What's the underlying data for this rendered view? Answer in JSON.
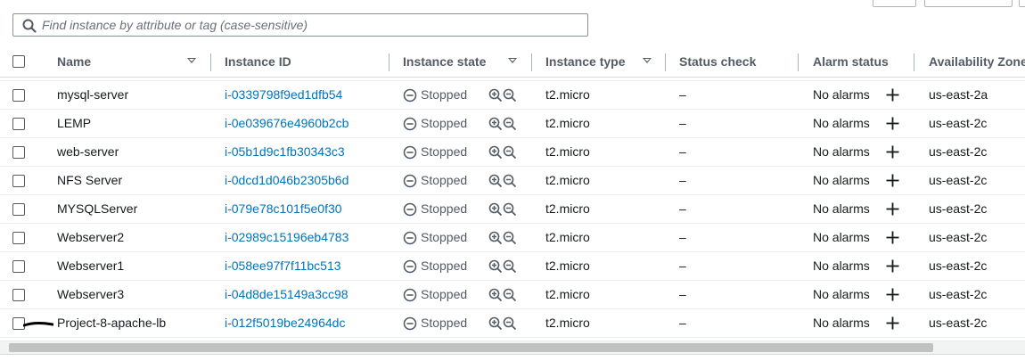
{
  "search": {
    "placeholder": "Find instance by attribute or tag (case-sensitive)",
    "value": ""
  },
  "columns": [
    {
      "label": "Name",
      "sortable": true
    },
    {
      "label": "Instance ID",
      "sortable": false
    },
    {
      "label": "Instance state",
      "sortable": true
    },
    {
      "label": "Instance type",
      "sortable": true
    },
    {
      "label": "Status check",
      "sortable": false
    },
    {
      "label": "Alarm status",
      "sortable": false
    },
    {
      "label": "Availability Zone",
      "sortable": false
    }
  ],
  "rows": [
    {
      "name": "mysql-server",
      "instance_id": "i-0339798f9ed1dfb54",
      "state": "Stopped",
      "type": "t2.micro",
      "status_check": "–",
      "alarm": "No alarms",
      "az": "us-east-2a"
    },
    {
      "name": "LEMP",
      "instance_id": "i-0e039676e4960b2cb",
      "state": "Stopped",
      "type": "t2.micro",
      "status_check": "–",
      "alarm": "No alarms",
      "az": "us-east-2c"
    },
    {
      "name": "web-server",
      "instance_id": "i-05b1d9c1fb30343c3",
      "state": "Stopped",
      "type": "t2.micro",
      "status_check": "–",
      "alarm": "No alarms",
      "az": "us-east-2c"
    },
    {
      "name": "NFS Server",
      "instance_id": "i-0dcd1d046b2305b6d",
      "state": "Stopped",
      "type": "t2.micro",
      "status_check": "–",
      "alarm": "No alarms",
      "az": "us-east-2c"
    },
    {
      "name": "MYSQLServer",
      "instance_id": "i-079e78c101f5e0f30",
      "state": "Stopped",
      "type": "t2.micro",
      "status_check": "–",
      "alarm": "No alarms",
      "az": "us-east-2c"
    },
    {
      "name": "Webserver2",
      "instance_id": "i-02989c15196eb4783",
      "state": "Stopped",
      "type": "t2.micro",
      "status_check": "–",
      "alarm": "No alarms",
      "az": "us-east-2c"
    },
    {
      "name": "Webserver1",
      "instance_id": "i-058ee97f7f11bc513",
      "state": "Stopped",
      "type": "t2.micro",
      "status_check": "–",
      "alarm": "No alarms",
      "az": "us-east-2c"
    },
    {
      "name": "Webserver3",
      "instance_id": "i-04d8de15149a3cc98",
      "state": "Stopped",
      "type": "t2.micro",
      "status_check": "–",
      "alarm": "No alarms",
      "az": "us-east-2c"
    },
    {
      "name": "Project-8-apache-lb",
      "instance_id": "i-012f5019be24964dc",
      "state": "Stopped",
      "type": "t2.micro",
      "status_check": "–",
      "alarm": "No alarms",
      "az": "us-east-2c"
    }
  ],
  "icons": {
    "search": "search-icon",
    "state": "stopped-circle-icon",
    "zoom_in": "zoom-in-icon",
    "zoom_out": "zoom-out-icon",
    "add_alarm": "plus-icon"
  },
  "colors": {
    "link": "#0073bb",
    "text": "#16191f",
    "muted": "#545b64",
    "border": "#d5dbdb"
  }
}
